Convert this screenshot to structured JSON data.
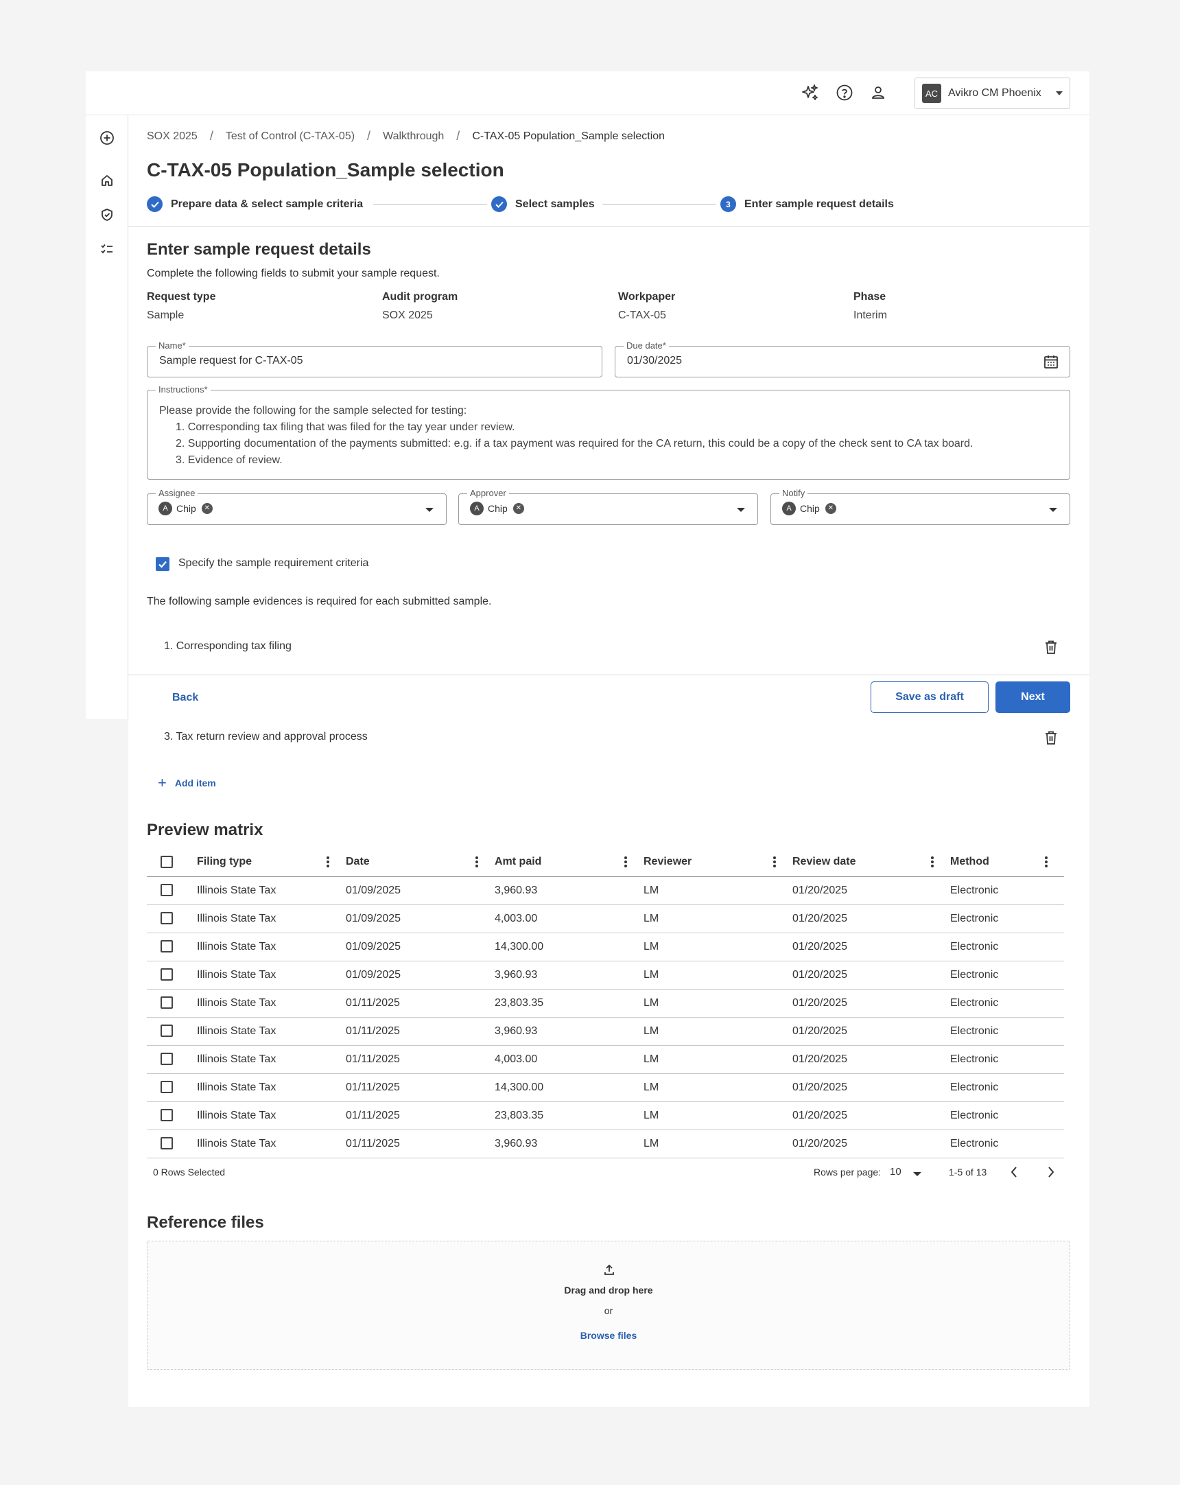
{
  "topbar": {
    "ai_icon": "sparkle-icon",
    "help_icon": "help-circle-icon",
    "user_icon": "user-icon",
    "account": {
      "initials": "AC",
      "name": "Avikro CM Phoenix"
    }
  },
  "leftnav": [
    "plus-circle-icon",
    "home-icon",
    "shield-check-icon",
    "checklist-icon"
  ],
  "breadcrumb": {
    "items": [
      "SOX 2025",
      "Test of Control (C-TAX-05)",
      "Walkthrough",
      "C-TAX-05 Population_Sample selection"
    ],
    "separator": "/"
  },
  "page_title": "C-TAX-05 Population_Sample selection",
  "stepper": {
    "steps": [
      {
        "label": "Prepare data & select sample criteria",
        "state": "complete"
      },
      {
        "label": "Select samples",
        "state": "complete"
      },
      {
        "label": "Enter sample request details",
        "state": "active",
        "number": "3"
      }
    ]
  },
  "section": {
    "title": "Enter sample request details",
    "subtitle": "Complete the following fields to submit your sample request."
  },
  "meta": [
    {
      "label": "Request type",
      "value": "Sample"
    },
    {
      "label": "Audit program",
      "value": "SOX  2025"
    },
    {
      "label": "Workpaper",
      "value": "C-TAX-05"
    },
    {
      "label": "Phase",
      "value": "Interim"
    }
  ],
  "form": {
    "name": {
      "label": "Name*",
      "value": "Sample request for C-TAX-05"
    },
    "due_date": {
      "label": "Due date*",
      "value": "01/30/2025"
    },
    "instructions": {
      "label": "Instructions*",
      "intro": "Please provide the following for the sample selected for testing:",
      "items": [
        "1. Corresponding tax filing that was filed for the tay year under review.",
        "2. Supporting documentation of the payments submitted: e.g. if a tax payment was required for the CA return, this could be a copy of the check sent to CA tax board.",
        "3. Evidence of review."
      ]
    },
    "assignee": {
      "label": "Assignee",
      "chip": "Chip",
      "chip_initial": "A"
    },
    "approver": {
      "label": "Approver",
      "chip": "Chip",
      "chip_initial": "A"
    },
    "notify": {
      "label": "Notify",
      "chip": "Chip",
      "chip_initial": "A"
    }
  },
  "criteria": {
    "checkbox_label": "Specify the sample requirement criteria",
    "checked": true,
    "note": "The following sample evidences is required for each submitted sample.",
    "items": [
      "1. Corresponding tax filing",
      "3. Tax return review and approval process"
    ],
    "add_item": "Add item"
  },
  "actions": {
    "back": "Back",
    "save_draft": "Save as draft",
    "next": "Next"
  },
  "preview": {
    "title": "Preview matrix",
    "columns": [
      "Filing type",
      "Date",
      "Amt paid",
      "Reviewer",
      "Review date",
      "Method"
    ],
    "rows": [
      [
        "Illinois State Tax",
        "01/09/2025",
        "3,960.93",
        "LM",
        "01/20/2025",
        "Electronic"
      ],
      [
        "Illinois State Tax",
        "01/09/2025",
        "4,003.00",
        "LM",
        "01/20/2025",
        "Electronic"
      ],
      [
        "Illinois State Tax",
        "01/09/2025",
        "14,300.00",
        "LM",
        "01/20/2025",
        "Electronic"
      ],
      [
        "Illinois State Tax",
        "01/09/2025",
        "3,960.93",
        "LM",
        "01/20/2025",
        "Electronic"
      ],
      [
        "Illinois State Tax",
        "01/11/2025",
        "23,803.35",
        "LM",
        "01/20/2025",
        "Electronic"
      ],
      [
        "Illinois State Tax",
        "01/11/2025",
        "3,960.93",
        "LM",
        "01/20/2025",
        "Electronic"
      ],
      [
        "Illinois State Tax",
        "01/11/2025",
        "4,003.00",
        "LM",
        "01/20/2025",
        "Electronic"
      ],
      [
        "Illinois State Tax",
        "01/11/2025",
        "14,300.00",
        "LM",
        "01/20/2025",
        "Electronic"
      ],
      [
        "Illinois State Tax",
        "01/11/2025",
        "23,803.35",
        "LM",
        "01/20/2025",
        "Electronic"
      ],
      [
        "Illinois State Tax",
        "01/11/2025",
        "3,960.93",
        "LM",
        "01/20/2025",
        "Electronic"
      ]
    ],
    "rows_selected": "0 Rows Selected",
    "rows_per_page_label": "Rows per page:",
    "rows_per_page": "10",
    "range": "1-5 of 13"
  },
  "reference": {
    "title": "Reference files",
    "drag": "Drag and drop here",
    "or": "or",
    "browse": "Browse files"
  },
  "colors": {
    "primary": "#2e6bc6",
    "link": "#2a5fb0"
  }
}
